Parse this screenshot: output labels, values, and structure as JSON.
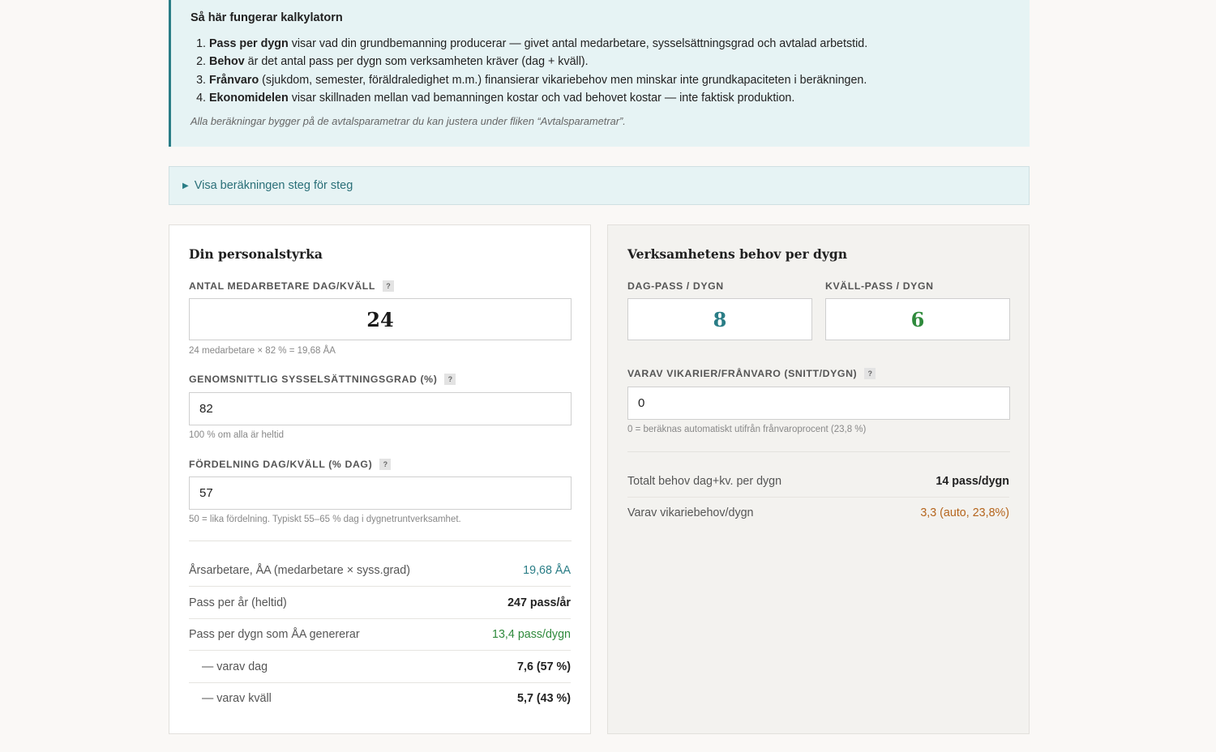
{
  "info": {
    "title": "Så här fungerar kalkylatorn",
    "items": [
      {
        "bold": "Pass per dygn",
        "text": " visar vad din grundbemanning producerar — givet antal medarbetare, sysselsättningsgrad och avtalad arbetstid."
      },
      {
        "bold": "Behov",
        "text": " är det antal pass per dygn som verksamheten kräver (dag + kväll)."
      },
      {
        "bold": "Frånvaro",
        "text": " (sjukdom, semester, föräldraledighet m.m.) finansierar vikariebehov men minskar inte grundkapaciteten i beräkningen."
      },
      {
        "bold": "Ekonomidelen",
        "text": " visar skillnaden mellan vad bemanningen kostar och vad behovet kostar — inte faktisk produktion."
      }
    ],
    "note": "Alla beräkningar bygger på de avtalsparametrar du kan justera under fliken “Avtalsparametrar”."
  },
  "disclosure": {
    "label": "Visa beräkningen steg för steg"
  },
  "left": {
    "title": "Din personalstyrka",
    "help_glyph": "?",
    "f1": {
      "label": "Antal medarbetare dag/kväll",
      "value": "24",
      "hint": "24 medarbetare × 82 % = 19,68 ÅA"
    },
    "f2": {
      "label": "Genomsnittlig sysselsättningsgrad (%)",
      "value": "82",
      "hint": "100 % om alla är heltid"
    },
    "f3": {
      "label": "Fördelning dag/kväll (% dag)",
      "value": "57",
      "hint": "50 = lika fördelning. Typiskt 55–65 % dag i dygnetruntverksamhet."
    },
    "rows": [
      {
        "label": "Årsarbetare, ÅA (medarbetare × syss.grad)",
        "value": "19,68 ÅA"
      },
      {
        "label": "Pass per år (heltid)",
        "value": "247 pass/år"
      },
      {
        "label": "Pass per dygn som ÅA genererar",
        "value": "13,4 pass/dygn"
      },
      {
        "label": "— varav dag",
        "value": "7,6 (57 %)"
      },
      {
        "label": "— varav kväll",
        "value": "5,7 (43 %)"
      }
    ]
  },
  "right": {
    "title": "Verksamhetens behov per dygn",
    "help_glyph": "?",
    "dag": {
      "label": "Dag-pass / dygn",
      "value": "8"
    },
    "kvall": {
      "label": "Kväll-pass / dygn",
      "value": "6"
    },
    "vik": {
      "label": "Varav vikarier/frånvaro (snitt/dygn)",
      "value": "0",
      "hint": "0 = beräknas automatiskt utifrån frånvaroprocent (23,8 %)"
    },
    "rows": [
      {
        "label": "Totalt behov dag+kv. per dygn",
        "value": "14 pass/dygn"
      },
      {
        "label": "Varav vikariebehov/dygn",
        "value": "3,3 (auto, 23,8%)"
      }
    ]
  },
  "colors": {
    "accent": "#2a7d86",
    "green": "#2f8a3c",
    "orange": "#b5651d",
    "info_bg": "#e6f3f4"
  }
}
